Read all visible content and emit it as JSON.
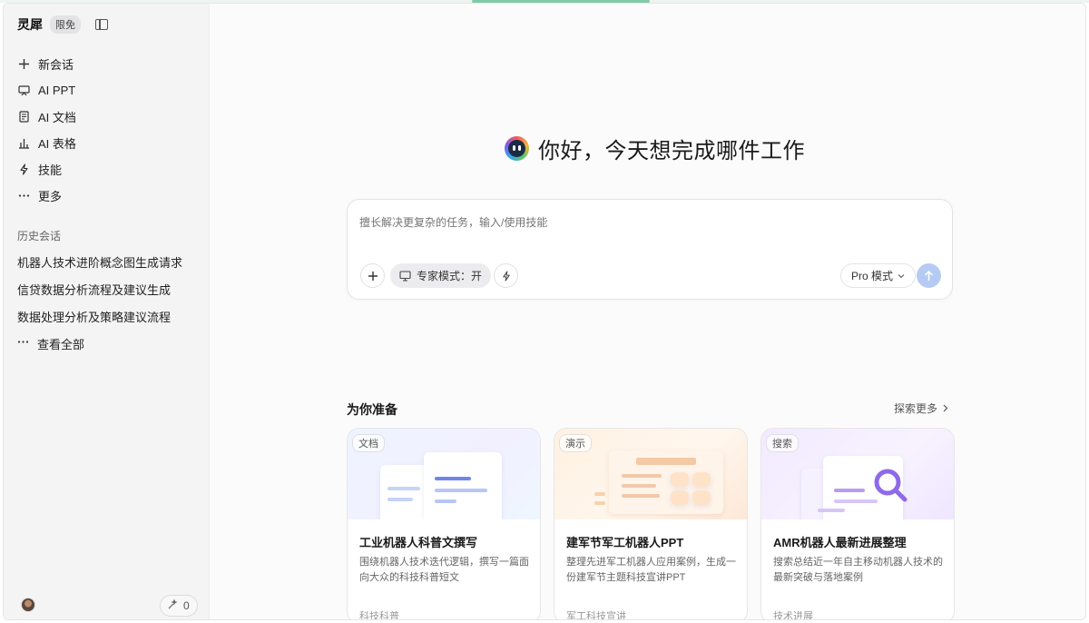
{
  "brand": {
    "name": "灵犀",
    "badge": "限免"
  },
  "nav": [
    {
      "icon": "plus-icon",
      "glyph": "＋",
      "label": "新会话"
    },
    {
      "icon": "presentation-icon",
      "glyph": "▭",
      "label": "AI PPT"
    },
    {
      "icon": "document-icon",
      "glyph": "▤",
      "label": "AI 文档"
    },
    {
      "icon": "chart-icon",
      "glyph": "▥",
      "label": "AI 表格"
    },
    {
      "icon": "lightning-icon",
      "glyph": "ϟ",
      "label": "技能"
    },
    {
      "icon": "more-icon",
      "glyph": "⋯",
      "label": "更多"
    }
  ],
  "history": {
    "title": "历史会话",
    "items": [
      "机器人技术进阶概念图生成请求",
      "信贷数据分析流程及建议生成",
      "数据处理分析及策略建议流程"
    ],
    "view_all": "查看全部"
  },
  "footer": {
    "count": "0"
  },
  "greeting": "你好，今天想完成哪件工作",
  "composer": {
    "placeholder": "擅长解决更复杂的任务，输入/使用技能",
    "mode_label": "专家模式：开",
    "pro_label": "Pro 模式"
  },
  "prepared": {
    "title": "为你准备",
    "explore": "探索更多"
  },
  "cards": [
    {
      "tag": "文档",
      "title": "工业机器人科普文撰写",
      "desc": "围绕机器人技术迭代逻辑，撰写一篇面向大众的科技科普短文",
      "foot": "科技科普"
    },
    {
      "tag": "演示",
      "title": "建军节军工机器人PPT",
      "desc": "整理先进军工机器人应用案例，生成一份建军节主题科技宣讲PPT",
      "foot": "军工科技宣讲"
    },
    {
      "tag": "搜索",
      "title": "AMR机器人最新进展整理",
      "desc": "搜索总结近一年自主移动机器人技术的最新突破与落地案例",
      "foot": "技术进展"
    }
  ],
  "colors": {
    "accent": "#b6cbf3",
    "sidebar_bg": "#f4f4f5",
    "main_bg": "#fbfbfb"
  }
}
